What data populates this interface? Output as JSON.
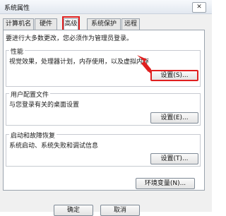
{
  "window": {
    "title": "系统属性",
    "close_label": "✕"
  },
  "tabs": [
    {
      "label": "计算机名"
    },
    {
      "label": "硬件"
    },
    {
      "label": "高级"
    },
    {
      "label": "系统保护"
    },
    {
      "label": "远程"
    }
  ],
  "panel": {
    "admin_note": "要进行大多数更改，您必须作为管理员登录。",
    "performance": {
      "title": "性能",
      "description": "视觉效果，处理器计划，内存使用，以及虚拟内存",
      "button_label": "设置(S)..."
    },
    "user_profiles": {
      "title": "用户配置文件",
      "description": "与您登录有关的桌面设置",
      "button_label": "设置(E)..."
    },
    "startup_recovery": {
      "title": "启动和故障恢复",
      "description": "系统启动、系统失败和调试信息",
      "button_label": "设置(T)..."
    },
    "env_button_label": "环境变量(N)..."
  },
  "footer": {
    "ok_label": "确定",
    "cancel_label": "取消"
  },
  "colors": {
    "highlight": "#e02020"
  }
}
